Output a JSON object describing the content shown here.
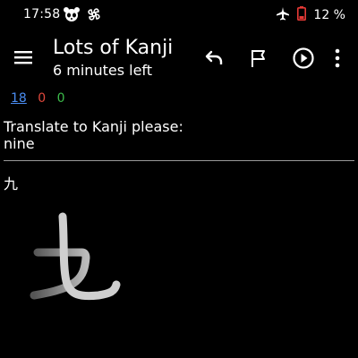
{
  "status_bar": {
    "time": "17:58",
    "battery": "12 %",
    "icons": [
      "panda-icon",
      "pinwheel-icon",
      "airplane-icon",
      "battery-icon"
    ]
  },
  "appbar": {
    "title": "Lots of Kanji",
    "subtitle": "6 minutes left",
    "actions": [
      "undo-icon",
      "flag-icon",
      "play-icon",
      "more-vert-icon"
    ]
  },
  "counts": {
    "new": "18",
    "learning": "0",
    "review": "0"
  },
  "card": {
    "question_line1": "Translate to Kanji please:",
    "question_line2": "nine",
    "answer_small": "九"
  },
  "colors": {
    "background": "#000000",
    "new_count": "#4a8df2",
    "learn_count": "#e0483c",
    "review_count": "#3cbc4b",
    "battery_low": "#e53935"
  }
}
